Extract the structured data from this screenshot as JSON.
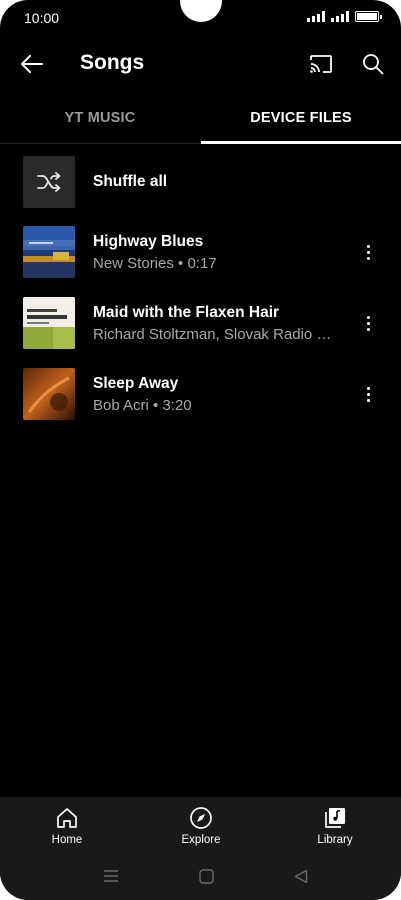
{
  "status_bar": {
    "time": "10:00"
  },
  "app_bar": {
    "title": "Songs"
  },
  "tabs": [
    {
      "label": "YT MUSIC",
      "selected": false
    },
    {
      "label": "DEVICE FILES",
      "selected": true
    }
  ],
  "shuffle": {
    "label": "Shuffle all"
  },
  "songs": [
    {
      "title": "Highway Blues",
      "subtitle": "New Stories • 0:17",
      "art": "blue-album-art"
    },
    {
      "title": "Maid with the Flaxen Hair",
      "subtitle": "Richard Stoltzman, Slovak Radio …",
      "art": "richard-stoltzman-album-art"
    },
    {
      "title": "Sleep Away",
      "subtitle": "Bob Acri • 3:20",
      "art": "orange-album-art"
    }
  ],
  "bottom_nav": [
    {
      "label": "Home",
      "icon": "home-icon"
    },
    {
      "label": "Explore",
      "icon": "compass-icon"
    },
    {
      "label": "Library",
      "icon": "library-icon"
    }
  ],
  "colors": {
    "background": "#000000",
    "nav_background": "#191919",
    "secondary_text": "#a8a8a8"
  }
}
